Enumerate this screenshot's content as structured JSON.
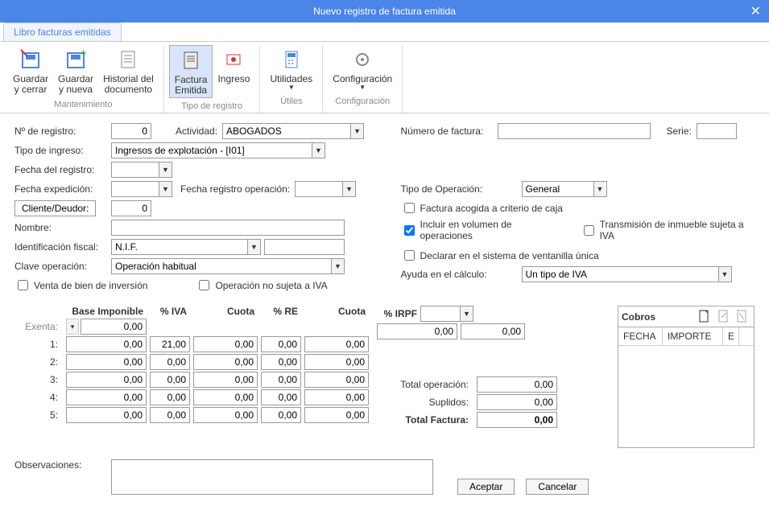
{
  "title": "Nuevo registro de factura emitida",
  "tab": "Libro facturas emitidas",
  "ribbon": {
    "grp_mant": "Mantenimiento",
    "grp_tipo": "Tipo de registro",
    "grp_util": "Útiles",
    "grp_conf": "Configuración",
    "guardar_cerrar": "Guardar\ny cerrar",
    "guardar_nueva": "Guardar\ny nueva",
    "historial": "Historial del\ndocumento",
    "factura_emitida": "Factura\nEmitida",
    "ingreso": "Ingreso",
    "utilidades": "Utilidades",
    "configuracion": "Configuración"
  },
  "labels": {
    "n_registro": "Nº de registro:",
    "actividad": "Actividad:",
    "numero_factura": "Número de factura:",
    "serie": "Serie:",
    "tipo_ingreso": "Tipo de ingreso:",
    "fecha_registro": "Fecha del registro:",
    "fecha_exped": "Fecha expedición:",
    "fecha_reg_op": "Fecha registro operación:",
    "tipo_operacion": "Tipo de Operación:",
    "cliente": "Cliente/Deudor:",
    "nombre": "Nombre:",
    "ident_fiscal": "Identificación fiscal:",
    "clave_op": "Clave operación:",
    "ayuda_calc": "Ayuda en el cálculo:",
    "venta_inversion": "Venta de bien de inversión",
    "op_no_sujeta": "Operación no sujeta a IVA",
    "factura_caja": "Factura acogida a criterio de caja",
    "incluir_vol": "Incluir en  volumen de operaciones",
    "transmision": "Transmisión de inmueble sujeta a IVA",
    "declarar_vent": "Declarar en el sistema de ventanilla única",
    "observaciones": "Observaciones:",
    "aceptar": "Aceptar",
    "cancelar": "Cancelar",
    "cobros": "Cobros",
    "fecha_col": "FECHA",
    "importe_col": "IMPORTE",
    "e_col": "E",
    "base_imp": "Base Imponible",
    "pct_iva": "% IVA",
    "cuota": "Cuota",
    "pct_re": "% RE",
    "pct_irpf": "% IRPF",
    "exenta": "Exenta:",
    "total_op": "Total operación:",
    "suplidos": "Suplidos:",
    "total_fac": "Total Factura:"
  },
  "values": {
    "n_registro": "0",
    "actividad": "ABOGADOS",
    "tipo_ingreso": "Ingresos de explotación - [I01]",
    "ident_fiscal": "N.I.F.",
    "clave_op": "Operación habitual",
    "tipo_operacion": "General",
    "ayuda_calc": "Un tipo de IVA",
    "cliente": "0",
    "incluir_vol_checked": true,
    "grid": {
      "exenta": {
        "base": "0,00",
        "irpf_base": "0,00",
        "irpf_cuota": "0,00"
      },
      "r1": {
        "label": "1:",
        "base": "0,00",
        "iva": "21,00",
        "cuota": "0,00",
        "re": "0,00",
        "cuota2": "0,00"
      },
      "r2": {
        "label": "2:",
        "base": "0,00",
        "iva": "0,00",
        "cuota": "0,00",
        "re": "0,00",
        "cuota2": "0,00"
      },
      "r3": {
        "label": "3:",
        "base": "0,00",
        "iva": "0,00",
        "cuota": "0,00",
        "re": "0,00",
        "cuota2": "0,00"
      },
      "r4": {
        "label": "4:",
        "base": "0,00",
        "iva": "0,00",
        "cuota": "0,00",
        "re": "0,00",
        "cuota2": "0,00"
      },
      "r5": {
        "label": "5:",
        "base": "0,00",
        "iva": "0,00",
        "cuota": "0,00",
        "re": "0,00",
        "cuota2": "0,00"
      }
    },
    "total_op": "0,00",
    "suplidos": "0,00",
    "total_fac": "0,00"
  }
}
